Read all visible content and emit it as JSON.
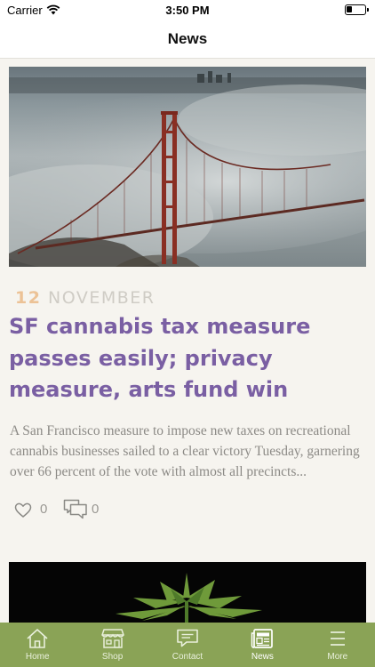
{
  "status_bar": {
    "carrier": "Carrier",
    "time": "3:50 PM"
  },
  "nav": {
    "title": "News"
  },
  "article": {
    "date_day": "12",
    "date_month": "NOVEMBER",
    "headline": "SF cannabis tax measure passes easily; privacy measure, arts fund win",
    "excerpt": "A San Francisco measure to impose new taxes on recreational cannabis businesses sailed to a clear victory Tuesday, garnering over 66 percent of the vote with almost all precincts...",
    "likes": "0",
    "comments": "0",
    "image_icon": "golden-gate-bridge-photo"
  },
  "second_article": {
    "image_icon": "cannabis-plant-photo"
  },
  "tab_bar": {
    "items": [
      {
        "label": "Home",
        "icon": "home-icon"
      },
      {
        "label": "Shop",
        "icon": "shop-icon"
      },
      {
        "label": "Contact",
        "icon": "contact-icon"
      },
      {
        "label": "News",
        "icon": "news-icon",
        "active": true
      },
      {
        "label": "More",
        "icon": "menu-icon"
      }
    ]
  },
  "colors": {
    "accent": "#7a5fa3",
    "date_day": "#ecc296",
    "tab_bar": "#8aa356",
    "background": "#f6f4ef"
  }
}
